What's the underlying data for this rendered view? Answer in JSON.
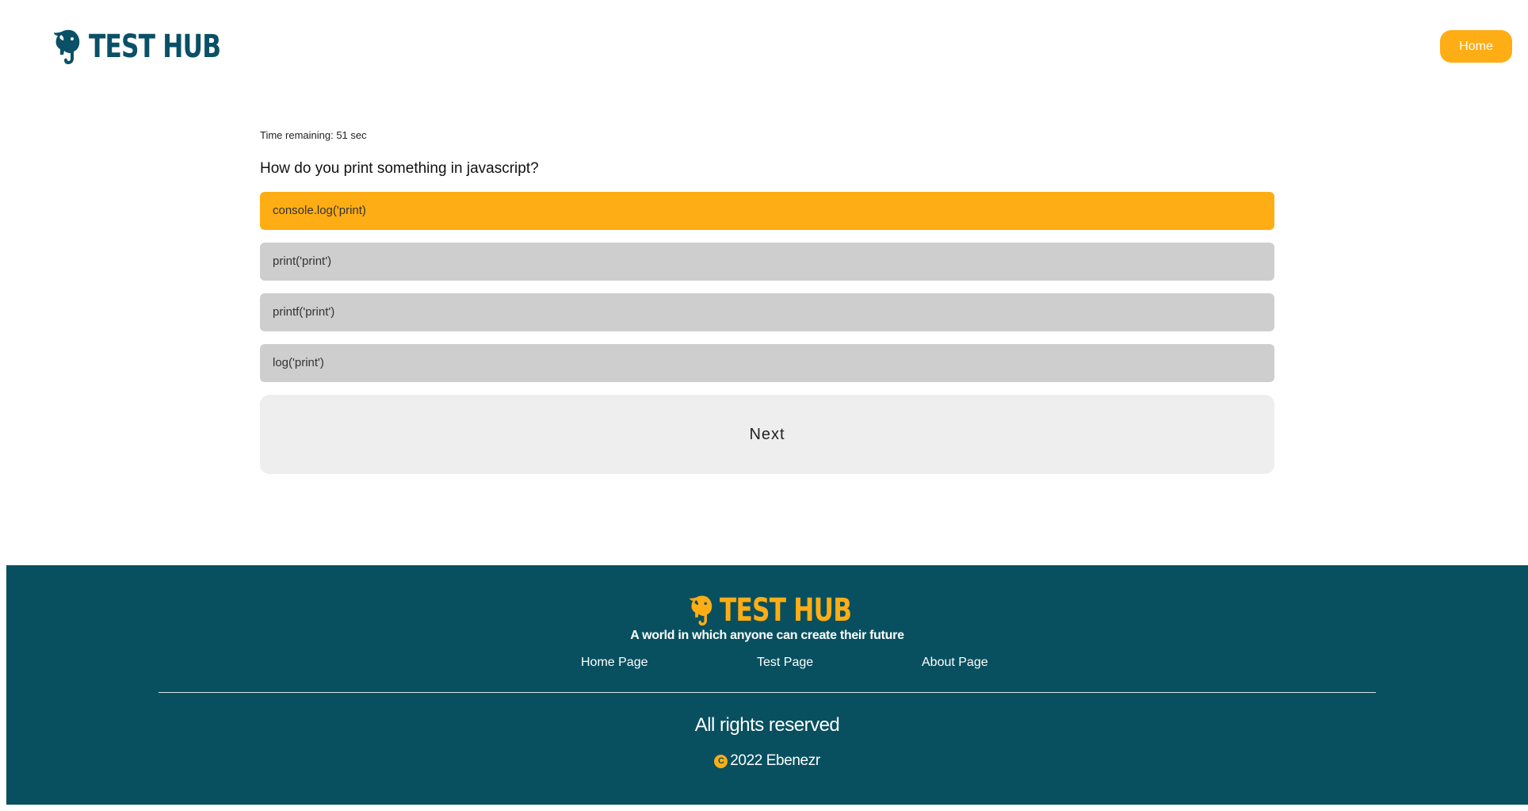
{
  "brand": {
    "name": "TEST HUB",
    "icon": "elephant-icon",
    "primary_color": "#0a5066",
    "accent_color": "#ffad14"
  },
  "header": {
    "home_label": "Home"
  },
  "quiz": {
    "timer_text": "Time remaining: 51 sec",
    "question": "How do you print something in javascript?",
    "options": [
      {
        "label": "console.log('print)",
        "selected": true
      },
      {
        "label": "print('print')",
        "selected": false
      },
      {
        "label": "printf('print')",
        "selected": false
      },
      {
        "label": "log('print')",
        "selected": false
      }
    ],
    "next_label": "Next"
  },
  "footer": {
    "brand_name": "TEST HUB",
    "tagline": "A world in which anyone can create their future",
    "links": [
      {
        "label": "Home Page"
      },
      {
        "label": "Test Page"
      },
      {
        "label": "About Page"
      }
    ],
    "rights": "All rights reserved",
    "copyright_symbol": "C",
    "copyright_text": "2022 Ebenezr",
    "background_color": "#08505f"
  }
}
